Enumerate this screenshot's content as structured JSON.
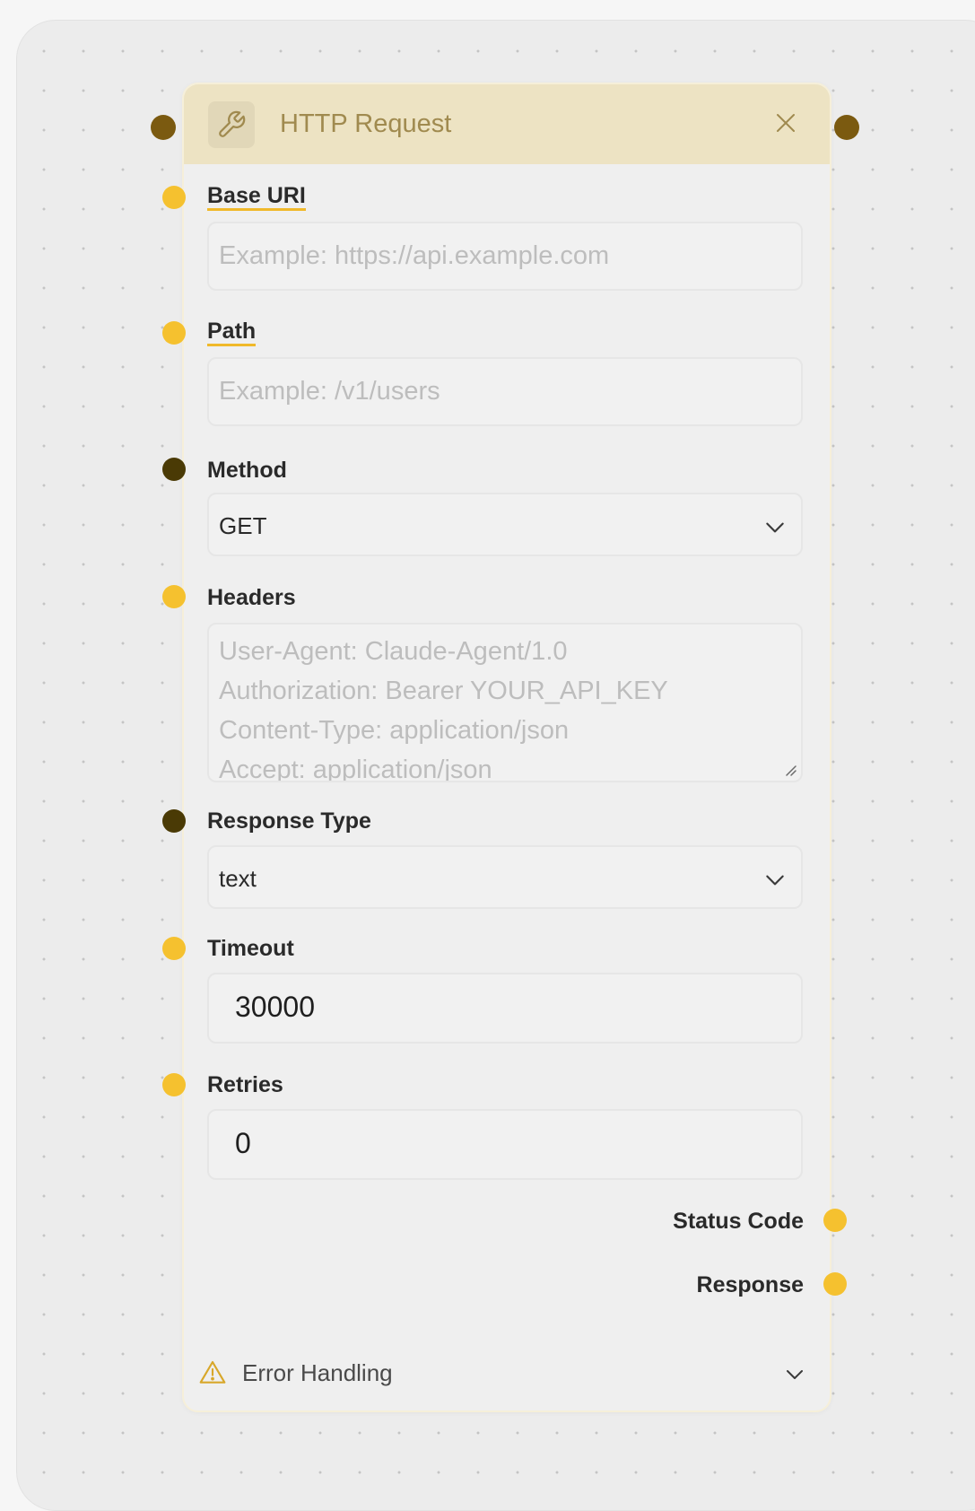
{
  "node": {
    "title": "HTTP Request",
    "icon": "wrench-icon",
    "header_color": "#ede3c3"
  },
  "fields": {
    "base_uri": {
      "label": "Base URI",
      "placeholder": "Example: https://api.example.com"
    },
    "path": {
      "label": "Path",
      "placeholder": "Example: /v1/users"
    },
    "method": {
      "label": "Method",
      "value": "GET"
    },
    "headers": {
      "label": "Headers",
      "placeholder_lines": [
        "User-Agent: Claude-Agent/1.0",
        "Authorization: Bearer YOUR_API_KEY",
        "Content-Type: application/json",
        "Accept: application/json"
      ]
    },
    "response_type": {
      "label": "Response Type",
      "value": "text"
    },
    "timeout": {
      "label": "Timeout",
      "value": "30000"
    },
    "retries": {
      "label": "Retries",
      "value": "0"
    }
  },
  "outputs": {
    "status_code": "Status Code",
    "response": "Response"
  },
  "footer": {
    "error_handling_label": "Error Handling"
  },
  "colors": {
    "port_gold": "#f5c12f",
    "port_dark": "#4a3a05",
    "accent_underline": "#f0b92a"
  }
}
